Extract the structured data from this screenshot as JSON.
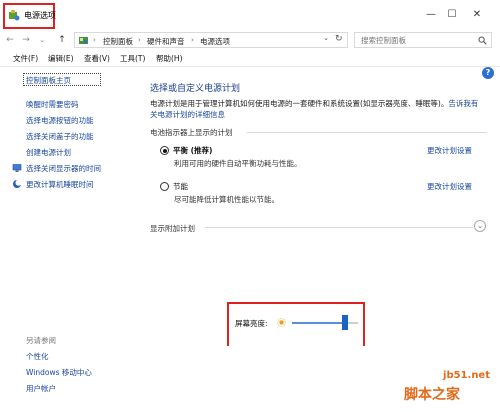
{
  "window": {
    "title": "电源选项",
    "controls": {
      "minimize": "—",
      "maximize": "☐",
      "close": "✕"
    }
  },
  "address": {
    "crumbs": [
      "控制面板",
      "硬件和声音",
      "电源选项"
    ],
    "search_placeholder": "搜索控制面板"
  },
  "menu": [
    "文件(F)",
    "编辑(E)",
    "查看(V)",
    "工具(T)",
    "帮助(H)"
  ],
  "sidebar": {
    "home": "控制面板主页",
    "items": [
      "唤醒时需要密码",
      "选择电源按钮的功能",
      "选择关闭盖子的功能",
      "创建电源计划",
      "选择关闭显示器的时间",
      "更改计算机睡眠时间"
    ],
    "see_also_label": "另请参阅",
    "see_also": [
      "个性化",
      "Windows 移动中心",
      "用户帐户"
    ]
  },
  "main": {
    "title": "选择或自定义电源计划",
    "description": "电源计划是用于管理计算机如何使用电源的一套硬件和系统设置(如显示器亮度、睡眠等)。",
    "description_link": "告诉我有关电源计划的详细信息",
    "battery_section_title": "电池指示器上显示的计划",
    "plans": [
      {
        "name": "平衡 (推荐)",
        "description": "利用可用的硬件自动平衡功耗与性能。",
        "link": "更改计划设置",
        "selected": true
      },
      {
        "name": "节能",
        "description": "尽可能降低计算机性能以节能。",
        "link": "更改计划设置",
        "selected": false
      }
    ],
    "additional_plans": "显示附加计划"
  },
  "brightness": {
    "label": "屏幕亮度:",
    "level_percent": 80
  },
  "watermark": {
    "url": "jb51.net",
    "logo": "脚本之家"
  },
  "colors": {
    "link": "#1a47a0",
    "title": "#1e3e8a",
    "highlight": "#e02020",
    "slider_thumb": "#1c62c6",
    "watermark": "#e26a1b"
  }
}
